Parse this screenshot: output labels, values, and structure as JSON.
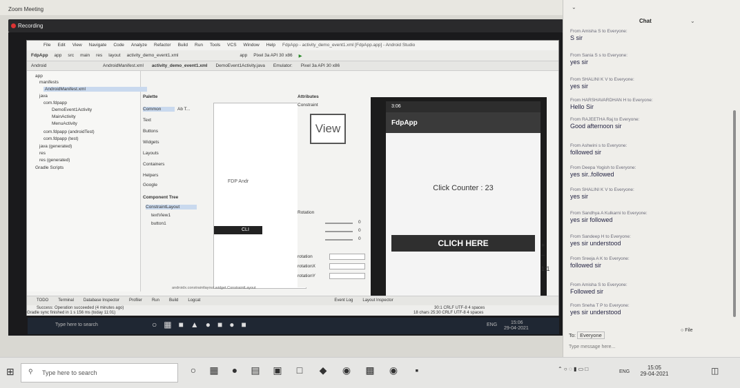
{
  "window": {
    "title": "Zoom Meeting"
  },
  "recording": {
    "label": "Recording"
  },
  "studio": {
    "menu": [
      "File",
      "Edit",
      "View",
      "Navigate",
      "Code",
      "Analyze",
      "Refactor",
      "Build",
      "Run",
      "Tools",
      "VCS",
      "Window",
      "Help"
    ],
    "title_path": "FdpApp - activity_demo_event1.xml [FdpApp.app] - Android Studio",
    "nav": [
      "FdpApp",
      "app",
      "src",
      "main",
      "res",
      "layout",
      "activity_demo_event1.xml"
    ],
    "run_config": "app",
    "device_run": "Pixel 3a API 30 x86",
    "tabs": [
      "AndroidManifest.xml",
      "activity_demo_event1.xml",
      "DemoEvent1Activity.java",
      "Emulator:",
      "Pixel 3a API 30 x86"
    ],
    "view_modes": [
      "Code",
      "Split",
      "Design"
    ],
    "project_label": "Android",
    "tree": [
      "app",
      "manifests",
      "AndroidManifest.xml",
      "java",
      "com.fdpapp",
      "DemoEvent1Activity",
      "MainActivity",
      "MenuActivity",
      "com.fdpapp (androidTest)",
      "com.fdpapp (test)",
      "java (generated)",
      "res",
      "res (generated)",
      "Gradle Scripts"
    ],
    "palette_title": "Palette",
    "palette": [
      "Common",
      "Text",
      "Buttons",
      "Widgets",
      "Layouts",
      "Containers",
      "Helpers",
      "Google"
    ],
    "palette_items": [
      "Ab T...",
      "TextView",
      "Button",
      "ImageView",
      "RecyclerView"
    ],
    "component_tree": {
      "title": "Component Tree",
      "root": "ConstraintLayout",
      "children": [
        "textView1",
        "button1"
      ]
    },
    "attributes": {
      "title": "Attributes",
      "constraint": "Constraint",
      "view_label": "View",
      "rotation_label": "Rotation",
      "zero": "0",
      "fields": [
        "rotation",
        "rotationX",
        "rotationY",
        "scaleX",
        "scaleY",
        "translationX",
        "translationY"
      ]
    },
    "canvas_preview": {
      "title": "FDP Andr",
      "button": "CLI"
    },
    "canvas_path": "androidx.constraintlayout.widget.ConstraintLayout",
    "bottom_tools": [
      "TODO",
      "Terminal",
      "Database Inspector",
      "Profiler",
      "Run",
      "Build",
      "Logcat",
      "Event Log",
      "Layout Inspector"
    ],
    "status": "Success: Operation succeeded (4 minutes ago)",
    "status2": "Gradle sync finished in 1 s 156 ms (today 11:01)",
    "cursor_pos": "30:1  CRLF  UTF-8  4 spaces",
    "cursor_pos2": "18 chars  25:30  CRLF  UTF-8  4 spaces"
  },
  "emulator": {
    "time": "3:06",
    "app_name": "FdpApp",
    "counter_text": "Click Counter : 23",
    "button_text": "CLICH HERE"
  },
  "chat": {
    "title": "Chat",
    "messages": [
      {
        "from": "From Amisha S to Everyone:",
        "text": "S sir"
      },
      {
        "from": "From Sania S s to Everyone:",
        "text": "yes sir"
      },
      {
        "from": "From SHALINI K V to Everyone:",
        "text": "yes sir"
      },
      {
        "from": "From HARSHAVARDHAN H to Everyone:",
        "text": "Hello Sir"
      },
      {
        "from": "From RAJEETHA Raj to Everyone:",
        "text": "Good afternoon sir"
      },
      {
        "from": "From Ashwini s to Everyone:",
        "text": "followed sir"
      },
      {
        "from": "From Deepa Yogish to Everyone:",
        "text": "yes sir..followed"
      },
      {
        "from": "From SHALINI K V to Everyone:",
        "text": "yes sir"
      },
      {
        "from": "From Sandhya A Kulkarni to Everyone:",
        "text": "yes sir followed"
      },
      {
        "from": "From Sandeep H to Everyone:",
        "text": "yes sir understood"
      },
      {
        "from": "From Sreeja A K to Everyone:",
        "text": "followed sir"
      },
      {
        "from": "From Amisha S to Everyone:",
        "text": "Followed sir"
      },
      {
        "from": "From Sneha T P to Everyone:",
        "text": "yes sir understood"
      }
    ],
    "to_label": "To:",
    "to_value": "Everyone",
    "file_label": "File",
    "input_placeholder": "Type message here..."
  },
  "inner_taskbar": {
    "search": "Type here to search",
    "time": "15:06",
    "date": "29-04-2021",
    "lang": "ENG"
  },
  "taskbar": {
    "search": "Type here to search",
    "time": "15:05",
    "date": "29-04-2021",
    "lang": "ENG"
  }
}
